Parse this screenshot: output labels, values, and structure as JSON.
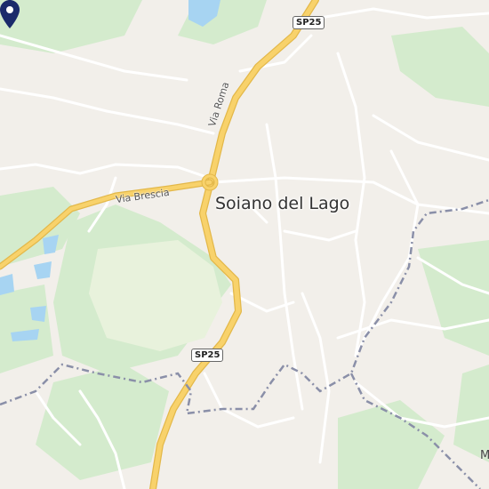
{
  "map": {
    "place_label": "Soiano del Lago",
    "road_badges": [
      "SP25",
      "SP25"
    ],
    "streets": [
      "Via Roma",
      "Via Brescia"
    ],
    "edge_label": "M",
    "marker_icon": "location-pin-icon",
    "colors": {
      "background": "#f2efea",
      "green": "#d4ebcd",
      "water": "#a7d4f2",
      "main_road": "#f8d26b",
      "main_road_casing": "#e3b84a",
      "minor_road": "#ffffff",
      "boundary": "#8a8fa8",
      "marker": "#1b2a6b"
    }
  }
}
